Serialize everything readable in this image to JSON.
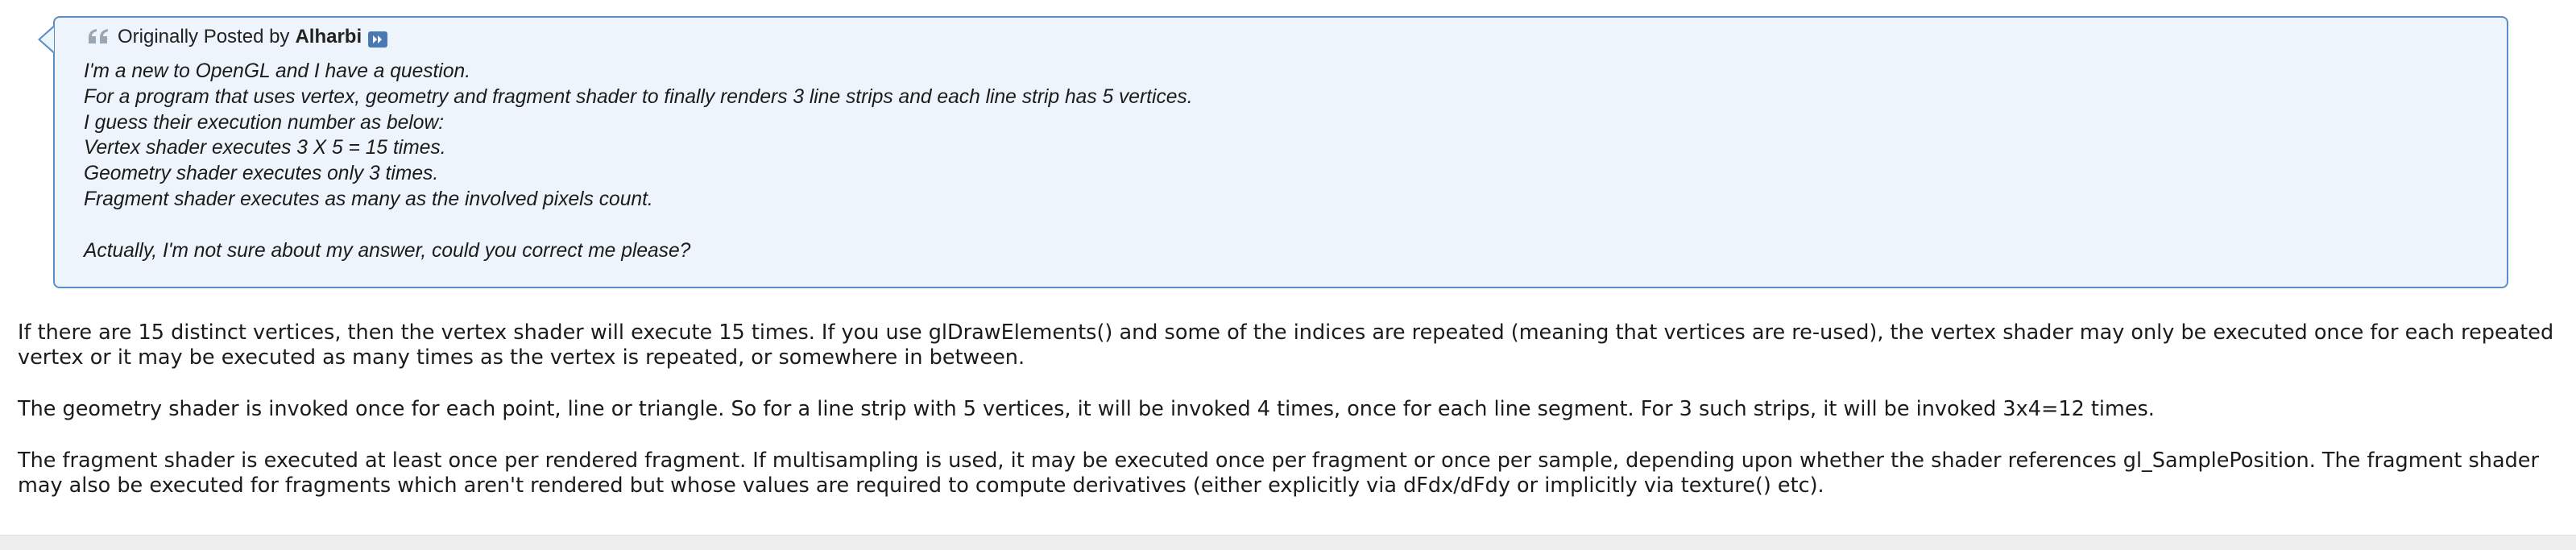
{
  "quote": {
    "posted_by_prefix": "Originally Posted by",
    "author": "Alharbi",
    "icon": "quote-icon",
    "view_post_icon": "arrow-right-icon",
    "lines": [
      "I'm a new to OpenGL and I have a question.",
      "For a program that uses vertex, geometry and fragment shader to finally renders 3 line strips and each line strip has 5 vertices.",
      "I guess their execution number as below:",
      "Vertex shader executes 3 X 5 = 15 times.",
      "Geometry shader executes only 3 times.",
      "Fragment shader executes as many as the involved pixels count.",
      "",
      "Actually, I'm not sure about my answer, could you correct me please?"
    ],
    "colors": {
      "background": "#eef4fb",
      "border": "#5b8fc3"
    }
  },
  "reply": {
    "paragraphs": [
      "If there are 15 distinct vertices, then the vertex shader will execute 15 times. If you use glDrawElements() and some of the indices are repeated (meaning that vertices are re-used), the vertex shader may only be executed once for each repeated vertex or it may be executed as many times as the vertex is repeated, or somewhere in between.",
      "The geometry shader is invoked once for each point, line or triangle. So for a line strip with 5 vertices, it will be invoked 4 times, once for each line segment. For 3 such strips, it will be invoked 3x4=12 times.",
      "The fragment shader is executed at least once per rendered fragment. If multisampling is used, it may be executed once per fragment or once per sample, depending upon whether the shader references gl_SamplePosition. The fragment shader may also be executed for fragments which aren't rendered but whose values are required to compute derivatives (either explicitly via dFdx/dFdy or implicitly via texture() etc)."
    ]
  }
}
